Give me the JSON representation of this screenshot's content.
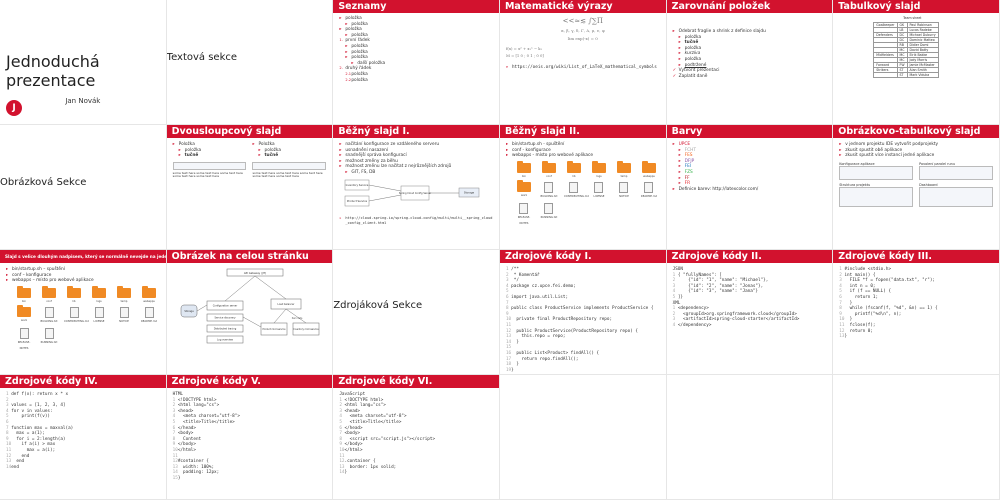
{
  "slides": {
    "title": {
      "title": "Jednoduchá prezentace",
      "author": "Jan Novák",
      "logo_letter": "J"
    },
    "text_section": {
      "title": "Textová sekce"
    },
    "lists": {
      "title": "Seznamy",
      "items": [
        "položka",
        "položka",
        "položka",
        "položka",
        "první řádek",
        "položka",
        "položka",
        "položka",
        "další položka",
        "druhý řádek",
        "položka",
        "položka"
      ],
      "nums": [
        "1.",
        "2.",
        "2.1",
        "2.2"
      ]
    },
    "math": {
      "title": "Matematické výrazy",
      "url": "https://oeis.org/wiki/List_of_LaTeX_mathematical_symbols"
    },
    "align": {
      "title": "Zarovnání položek",
      "items": [
        "Odebrat fraglie a shrink z definice slajdu",
        "položka",
        "tučně",
        "položka",
        "kurzíva",
        "položka",
        "podtržené",
        "Vytvořit prezentaci",
        "Zaplatit daně"
      ]
    },
    "table": {
      "title": "Tabulkový slajd",
      "caption": "Team sheet",
      "rows": [
        [
          "Goalkeeper",
          "GK",
          "Paul Robinson"
        ],
        [
          "",
          "LB",
          "Lucas Radebe"
        ],
        [
          "Defenders",
          "DC",
          "Michael Duburry"
        ],
        [
          "",
          "DC",
          "Dominic Matteo"
        ],
        [
          "",
          "RB",
          "Didier Domi"
        ],
        [
          "",
          "MC",
          "David Batty"
        ],
        [
          "Midfielders",
          "MC",
          "Eirik Bakke"
        ],
        [
          "",
          "MC",
          "Jody Morris"
        ],
        [
          "Forward",
          "FW",
          "Jamie McMaster"
        ],
        [
          "Strikers",
          "ST",
          "Alan Smith"
        ],
        [
          "",
          "ST",
          "Mark Viduka"
        ]
      ]
    },
    "image_section": {
      "title": "Obrázková Sekce"
    },
    "two_col": {
      "title": "Dvousloupcový slajd",
      "items": [
        "Položka",
        "položka",
        "tučně"
      ],
      "caption": "some text here some text here some text here some text here some text here"
    },
    "regular1": {
      "title": "Běžný slajd I.",
      "items": [
        "načítání konfigurace ze vzdáleného serveru",
        "usnadnění nasazení",
        "snadnější správa konfigurací",
        "možnost změny za běhu",
        "možnost změnu lze načítat z nejrůznějších zdrojů",
        "GIT, FS, DB"
      ],
      "diagram": [
        "Inventory Service",
        "Product Service",
        "Spring Cloud Config Server",
        "Storage"
      ],
      "url": "http://cloud.spring.io/spring-cloud-config/multi/multi__spring_cloud_config_client.html"
    },
    "regular2": {
      "title": "Běžný slajd II.",
      "items": [
        "bin/startup.sh - spuštění",
        "conf - konfigurace",
        "webapps - místo pro webové aplikace"
      ]
    },
    "colors": {
      "title": "Barvy",
      "items": [
        "UPCE",
        "FCHT",
        "FES",
        "DFJP",
        "FEI",
        "FZS",
        "FF",
        "FR",
        "Definice barev: http://latexcolor.com/"
      ]
    },
    "img_table": {
      "title": "Obrázkovo-tabulkový slajd",
      "items": [
        "v jednom projektu IDE vytvořit podprojekty",
        "zkusit spustit obě aplikace",
        "zkusit spustit více instancí jedné aplikace"
      ],
      "labels": [
        "Konfigurace aplikace",
        "Povolení paralel runu",
        "Struktura projektu",
        "Dashboard"
      ]
    },
    "long_title": {
      "title": "Slajd s velice dlouhým nadpisem, který se normálně nevejde na jeden řádek",
      "items": [
        "bin/startup.sh – spuštění",
        "conf – konfigurace",
        "webapps – místo pro webové aplikace"
      ]
    },
    "full_image": {
      "title": "Obrázek na celou stránku",
      "nodes": [
        "API Gateway (JIT)",
        "Storage",
        "Configuration server",
        "Service discovery",
        "Distributed tracing",
        "Log overview",
        "Load balancer",
        "Product microservice",
        "Inventory microservice",
        "Item data"
      ]
    },
    "code_section": {
      "title": "Zdrojáková Sekce"
    },
    "code1": {
      "title": "Zdrojové kódy I."
    },
    "code2": {
      "title": "Zdrojové kódy II.",
      "label": "JSON",
      "label2": "XML"
    },
    "code3": {
      "title": "Zdrojové kódy III."
    },
    "code4": {
      "title": "Zdrojové kódy IV."
    },
    "code5": {
      "title": "Zdrojové kódy V.",
      "label": "HTML"
    },
    "code6": {
      "title": "Zdrojové kódy VI.",
      "label": "JavaScript"
    },
    "folders": [
      "bin",
      "conf",
      "lib",
      "logs",
      "temp",
      "webapps",
      "work",
      "BUILDING.txt",
      "CONTRIBUTING.md",
      "LICENSE",
      "NOTICE",
      "README.md",
      "RELEASE-NOTES",
      "RUNNING.txt"
    ]
  }
}
